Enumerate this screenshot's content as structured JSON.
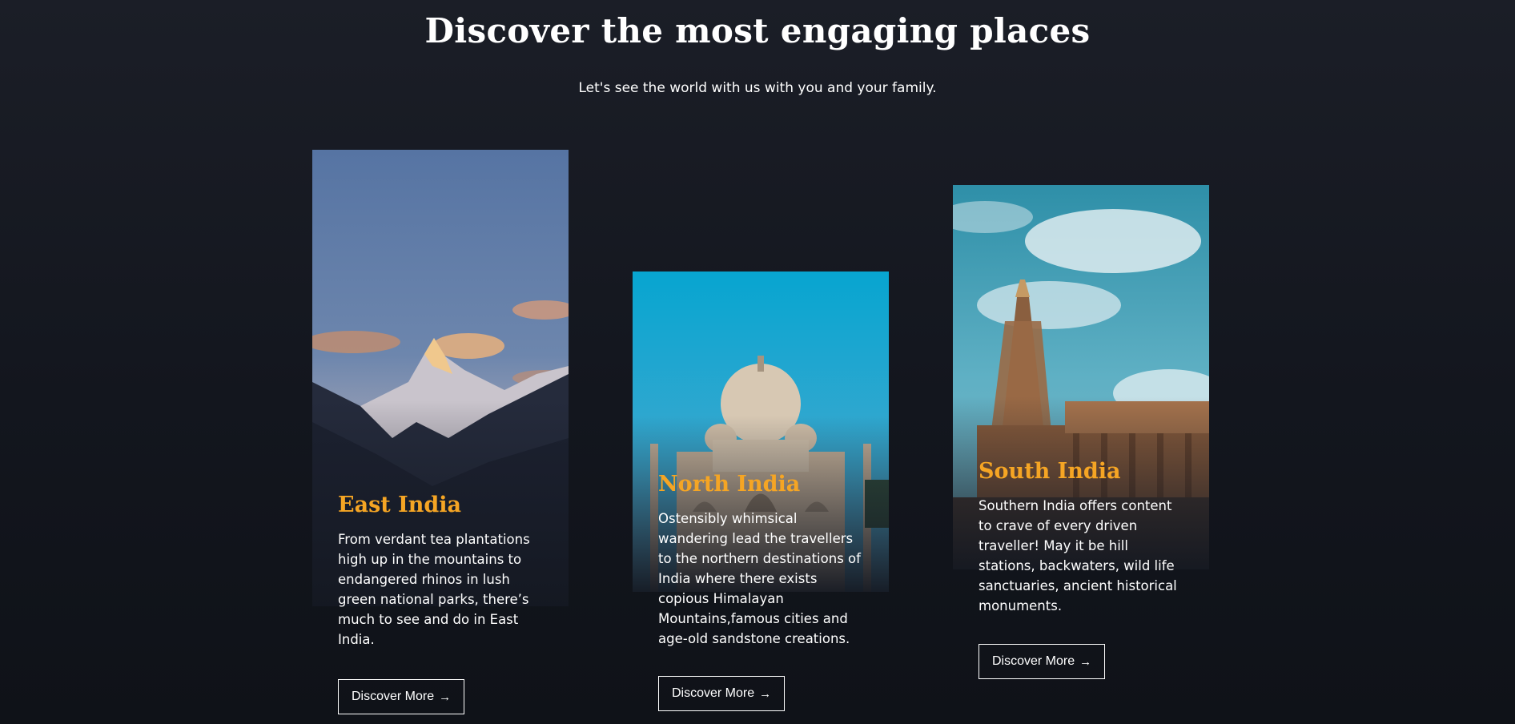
{
  "header": {
    "title": "Discover the most engaging places",
    "subtitle": "Let's see the world with us with you and your family."
  },
  "cards": [
    {
      "title": "East India",
      "description": "From verdant tea plantations high up in the mountains to endangered rhinos in lush green national parks, there’s much to see and do in East India.",
      "button_label": "Discover More",
      "image": "snow-mountain-peak-photo"
    },
    {
      "title": "North India",
      "description": "Ostensibly whimsical wandering lead the travellers to the northern destinations of India where there exists copious Himalayan Mountains,famous cities and age-old sandstone creations.",
      "button_label": "Discover More",
      "image": "taj-mahal-photo"
    },
    {
      "title": "South India",
      "description": "Southern India offers content to crave of every driven traveller! May it be hill stations, backwaters, wild life sanctuaries, ancient historical monuments.",
      "button_label": "Discover More",
      "image": "south-indian-temple-photo"
    }
  ],
  "icons": {
    "button_arrow": "arrow-right-icon"
  },
  "colors": {
    "background": "#13161e",
    "accent": "#f5a524",
    "text": "#ffffff"
  }
}
